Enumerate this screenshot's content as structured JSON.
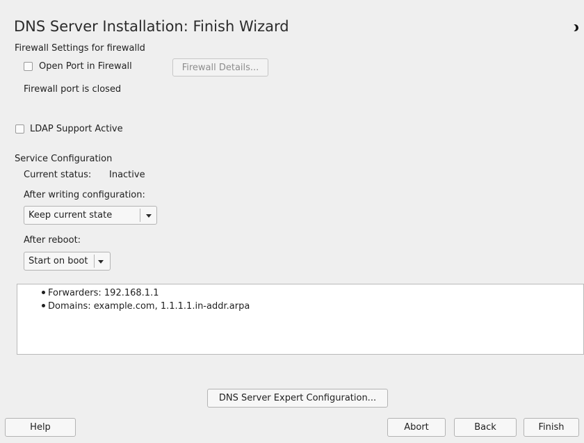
{
  "window": {
    "title": "DNS Server Installation: Finish Wizard"
  },
  "firewall": {
    "section_label": "Firewall Settings for firewalld",
    "open_port_label": "Open Port in Firewall",
    "open_port_checked": false,
    "details_button": "Firewall Details...",
    "status": "Firewall port is closed"
  },
  "ldap": {
    "label": "LDAP Support Active",
    "checked": false
  },
  "service": {
    "section_label": "Service Configuration",
    "current_status_label": "Current status:",
    "current_status_value": "Inactive",
    "after_writing_label": "After writing configuration:",
    "after_writing_value": "Keep current state",
    "after_reboot_label": "After reboot:",
    "after_reboot_value": "Start on boot"
  },
  "summary": {
    "items": [
      "Forwarders: 192.168.1.1",
      "Domains: example.com, 1.1.1.1.in-addr.arpa"
    ]
  },
  "expert_button": "DNS Server Expert Configuration...",
  "footer": {
    "help": "Help",
    "abort": "Abort",
    "back": "Back",
    "finish": "Finish"
  },
  "icons": {
    "moon": "moon-icon",
    "dropdown": "chevron-down-icon"
  },
  "colors": {
    "background": "#efefef",
    "panel": "#ffffff",
    "border": "#b3b3b3"
  }
}
